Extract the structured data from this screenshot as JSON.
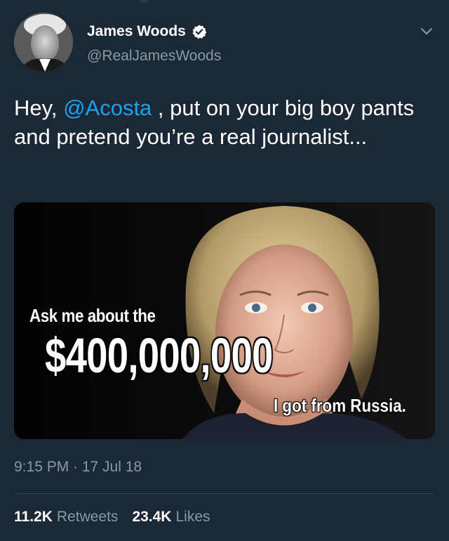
{
  "author": {
    "display_name": "James Woods",
    "handle": "@RealJamesWoods",
    "verified": true,
    "avatar_icon": "avatar-photo"
  },
  "tweet": {
    "text_prefix": "Hey, ",
    "mention": "@Acosta",
    "text_suffix": " , put on your big boy pants and pretend you’re a real journalist..."
  },
  "media": {
    "line1": "Ask me about the",
    "amount": "$400,000,000",
    "line3": "I got from Russia."
  },
  "meta": {
    "timestamp": "9:15 PM · 17 Jul 18"
  },
  "stats": {
    "retweets_count": "11.2K",
    "retweets_label": "Retweets",
    "likes_count": "23.4K",
    "likes_label": "Likes"
  },
  "colors": {
    "background": "#1b2836",
    "link": "#1da1f2",
    "secondary_text": "#8b98a5",
    "divider": "#38444d"
  }
}
